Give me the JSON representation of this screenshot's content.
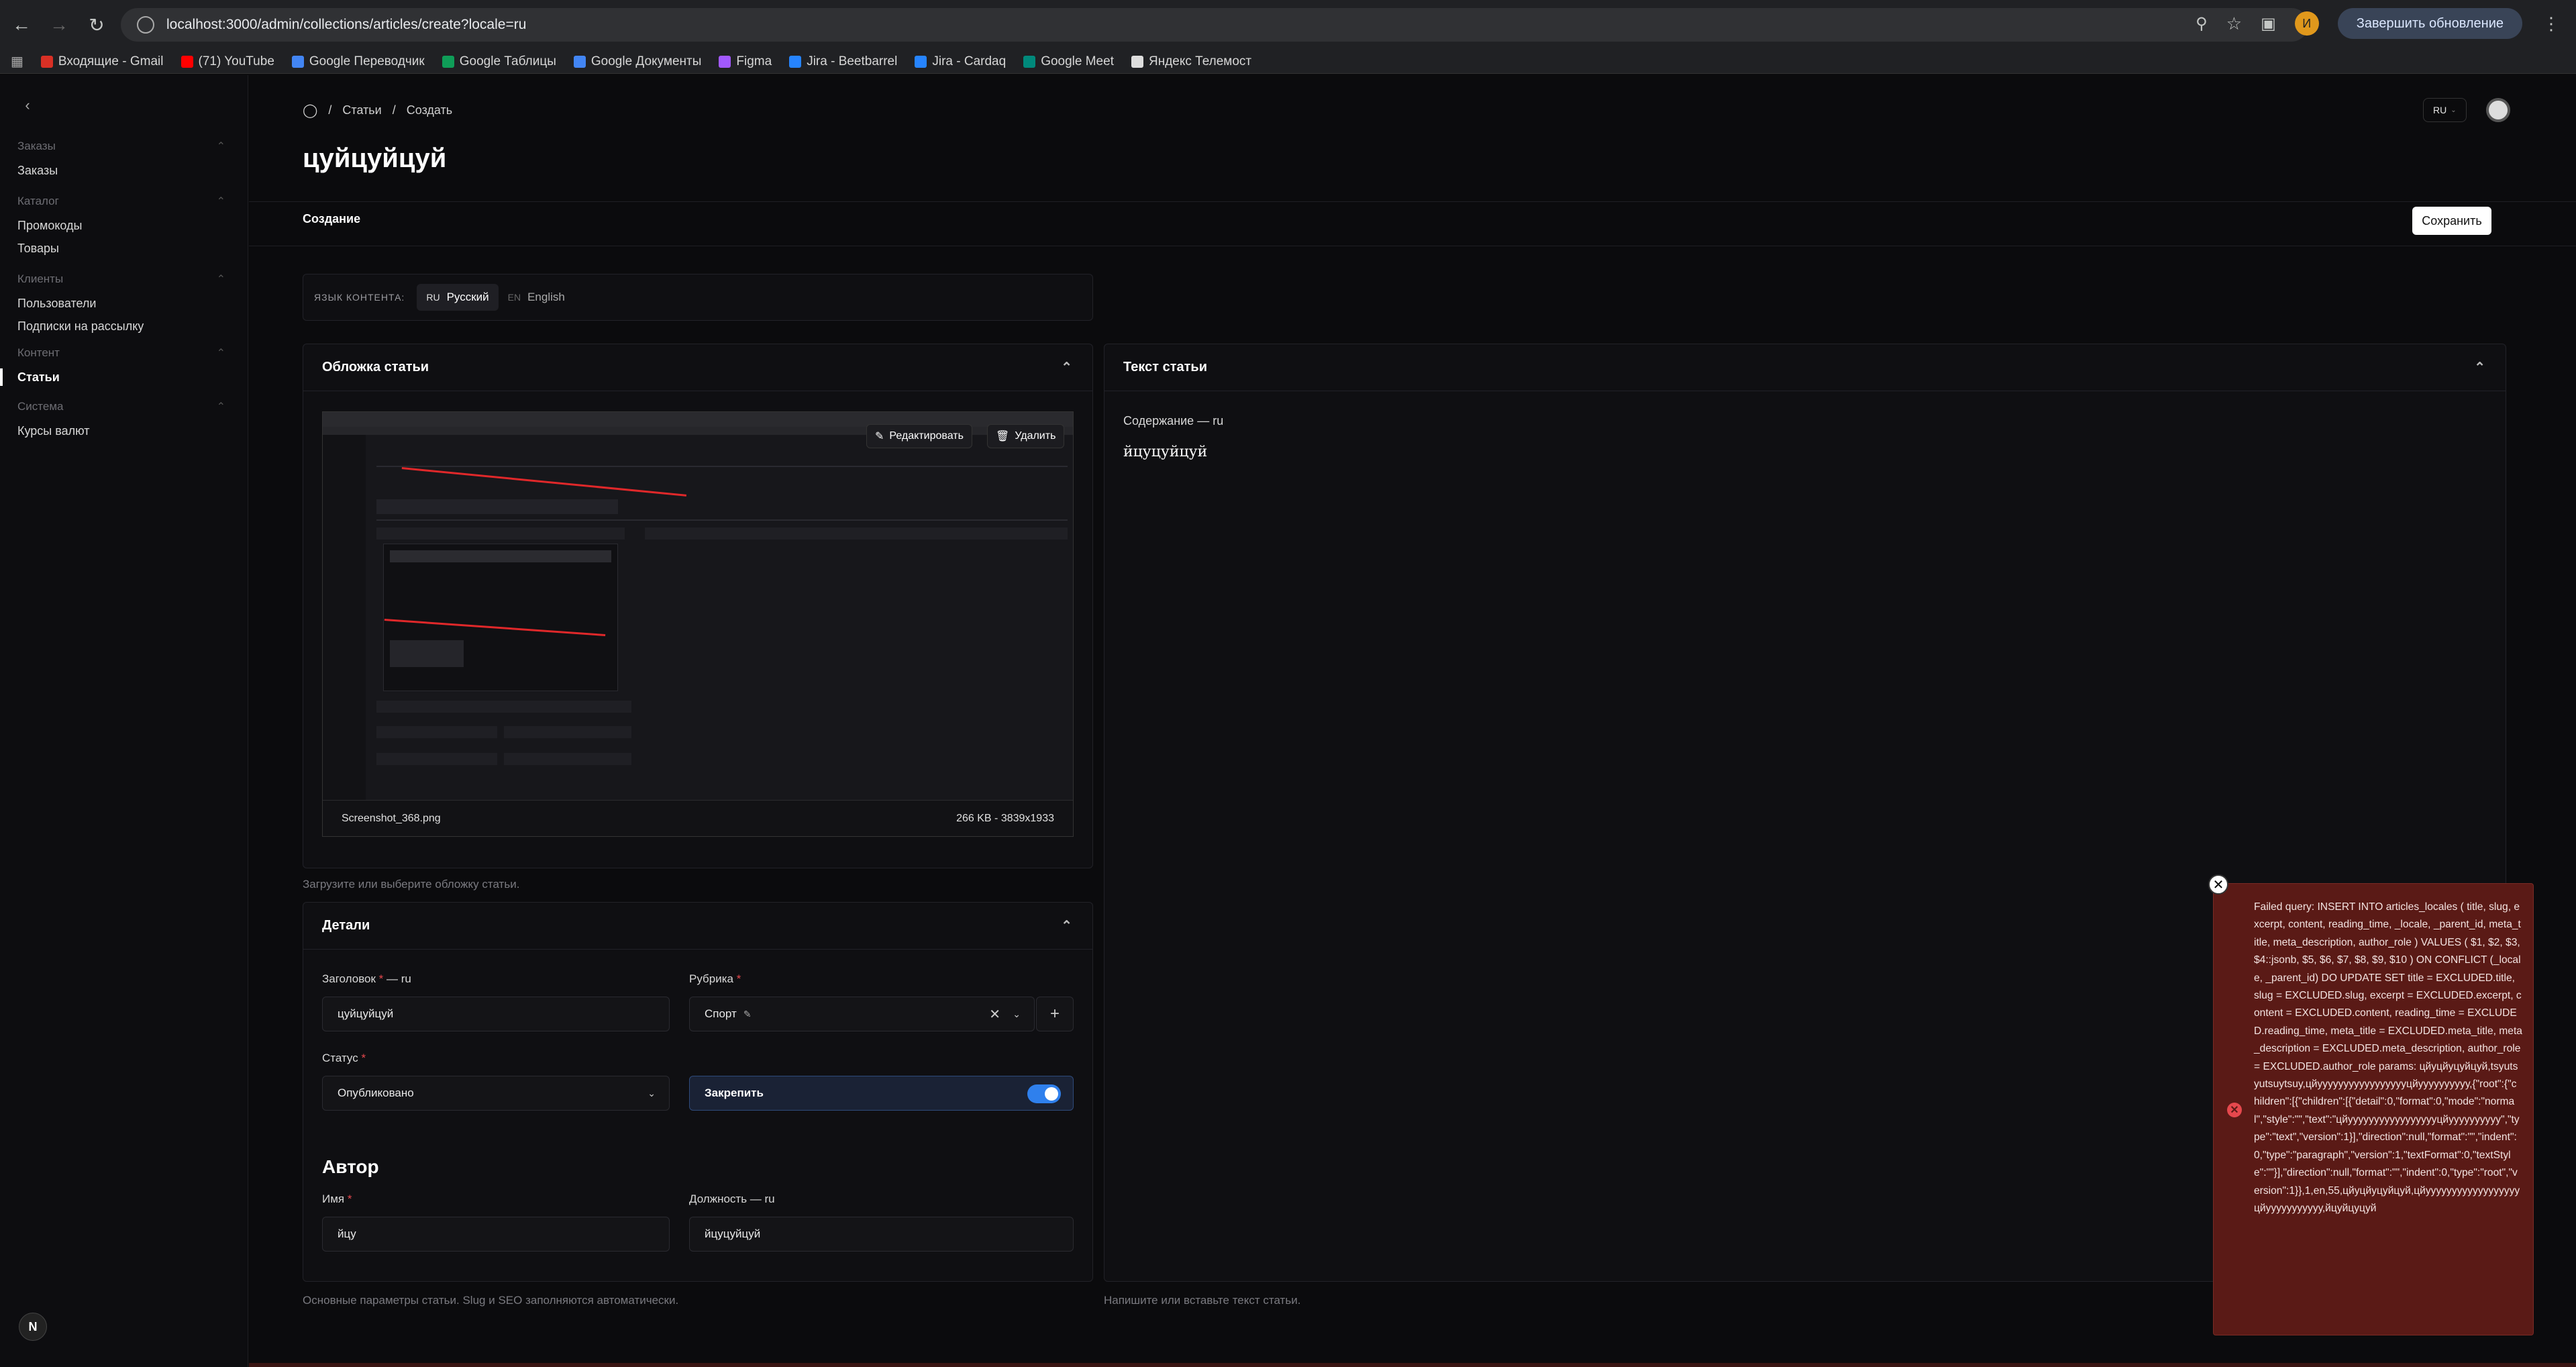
{
  "browser": {
    "url": "localhost:3000/admin/collections/articles/create?locale=ru",
    "update_label": "Завершить обновление",
    "profile_initial": "И",
    "bookmarks": [
      {
        "label": "Входящие - Gmail",
        "color": "#d93025"
      },
      {
        "label": "(71) YouTube",
        "color": "#ff0000"
      },
      {
        "label": "Google Переводчик",
        "color": "#4285f4"
      },
      {
        "label": "Google Таблицы",
        "color": "#0f9d58"
      },
      {
        "label": "Google Документы",
        "color": "#4285f4"
      },
      {
        "label": "Figma",
        "color": "#a259ff"
      },
      {
        "label": "Jira - Beetbarrel",
        "color": "#2684ff"
      },
      {
        "label": "Jira - Cardaq",
        "color": "#2684ff"
      },
      {
        "label": "Google Meet",
        "color": "#00897b"
      },
      {
        "label": "Яндекс Телемост",
        "color": "#dddddd"
      }
    ]
  },
  "sidebar": {
    "groups": [
      {
        "label": "Заказы",
        "items": [
          "Заказы"
        ]
      },
      {
        "label": "Каталог",
        "items": [
          "Промокоды",
          "Товары"
        ]
      },
      {
        "label": "Клиенты",
        "items": [
          "Пользователи",
          "Подписки на рассылку"
        ]
      },
      {
        "label": "Контент",
        "items": [
          "Статьи"
        ]
      },
      {
        "label": "Система",
        "items": [
          "Курсы валют"
        ]
      }
    ],
    "active_item": "Статьи",
    "logo_letter": "N"
  },
  "header": {
    "breadcrumb": [
      "Статьи",
      "Создать"
    ],
    "locale_pill": "RU",
    "title": "цуйцуйцуй",
    "tab": "Создание",
    "save_label": "Сохранить"
  },
  "language": {
    "label": "ЯЗЫК КОНТЕНТА:",
    "options": [
      {
        "code": "RU",
        "name": "Русский",
        "selected": true
      },
      {
        "code": "EN",
        "name": "English",
        "selected": false
      }
    ]
  },
  "cover": {
    "title": "Обложка статьи",
    "edit_label": "Редактировать",
    "delete_label": "Удалить",
    "file_name": "Screenshot_368.png",
    "file_meta": "266 KB - 3839x1933",
    "hint": "Загрузите или выберите обложку статьи."
  },
  "details": {
    "title": "Детали",
    "headline_label": "Заголовок",
    "headline_locale": "— ru",
    "headline_value": "цуйцуйцуй",
    "rubric_label": "Рубрика",
    "rubric_value": "Спорт",
    "status_label": "Статус",
    "status_value": "Опубликовано",
    "pin_label": "Закрепить",
    "pin_on": true,
    "author_title": "Автор",
    "name_label": "Имя",
    "name_value": "йцу",
    "position_label": "Должность",
    "position_locale": "— ru",
    "position_value": "йцуцуйцуй",
    "hint": "Основные параметры статьи. Slug и SEO заполняются автоматически."
  },
  "text_section": {
    "title": "Текст статьи",
    "content_label": "Содержание — ru",
    "content_value": "йцуцуйцуй",
    "hint": "Напишите или вставьте текст статьи."
  },
  "toast": {
    "message": "Failed query: INSERT INTO articles_locales ( title, slug, excerpt, content, reading_time, _locale, _parent_id, meta_title, meta_description, author_role ) VALUES ( $1, $2, $3, $4::jsonb, $5, $6, $7, $8, $9, $10 ) ON CONFLICT (_locale, _parent_id) DO UPDATE SET title = EXCLUDED.title, slug = EXCLUDED.slug, excerpt = EXCLUDED.excerpt, content = EXCLUDED.content, reading_time = EXCLUDED.reading_time, meta_title = EXCLUDED.meta_title, meta_description = EXCLUDED.meta_description, author_role = EXCLUDED.author_role params: цйуцйуцуйцуй,tsyutsyutsuytsuy,цйуууууууууууууууууцйуууууууууу,{\"root\":{\"children\":[{\"children\":[{\"detail\":0,\"format\":0,\"mode\":\"normal\",\"style\":\"\",\"text\":\"цйуууууууууууууууууцйуууууууууу\",\"type\":\"text\",\"version\":1}],\"direction\":null,\"format\":\"\",\"indent\":0,\"type\":\"paragraph\",\"version\":1,\"textFormat\":0,\"textStyle\":\"\"}],\"direction\":null,\"format\":\"\",\"indent\":0,\"type\":\"root\",\"version\":1}},1,en,55,цйуцйуцуйцуй,цйууууууууууууууууууцйууууууууууу,йцуйцуцуй"
  }
}
